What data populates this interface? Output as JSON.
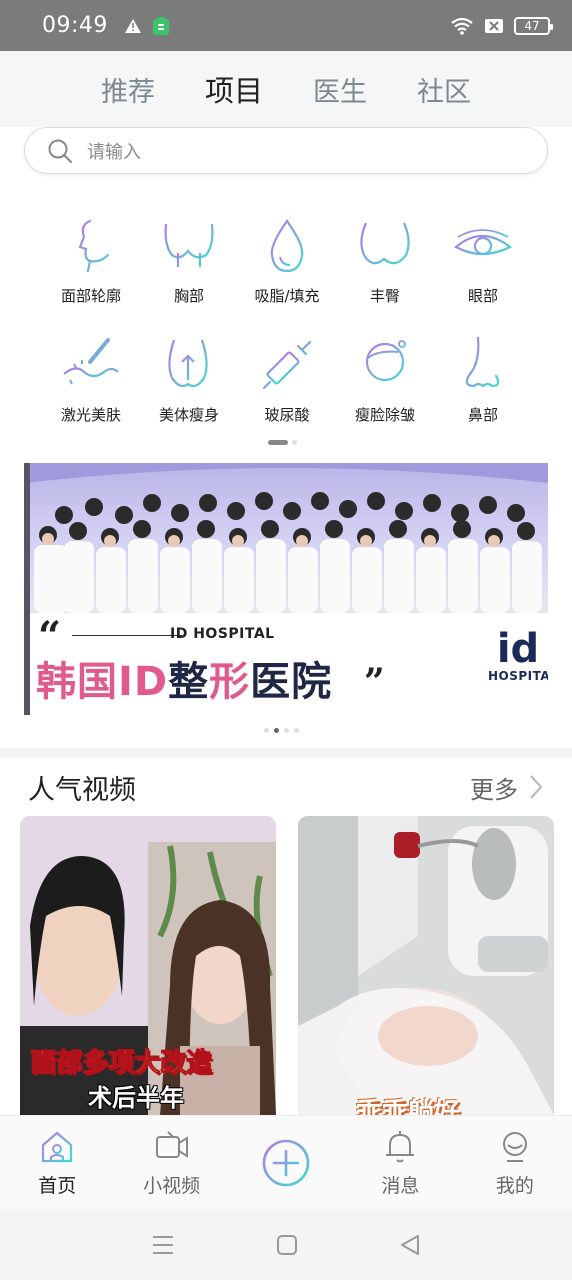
{
  "status_bar": {
    "time": "09:49",
    "battery": "47"
  },
  "top_tabs": [
    {
      "label": "推荐"
    },
    {
      "label": "项目"
    },
    {
      "label": "医生"
    },
    {
      "label": "社区"
    }
  ],
  "active_tab": "项目",
  "search": {
    "placeholder": "请输入"
  },
  "categories": [
    {
      "label": "面部轮廓",
      "icon": "face-contour-icon"
    },
    {
      "label": "胸部",
      "icon": "chest-icon"
    },
    {
      "label": "吸脂/填充",
      "icon": "liposuction-drop-icon"
    },
    {
      "label": "丰臀",
      "icon": "buttocks-icon"
    },
    {
      "label": "眼部",
      "icon": "eye-icon"
    },
    {
      "label": "激光美肤",
      "icon": "laser-skin-icon"
    },
    {
      "label": "美体瘦身",
      "icon": "body-slimming-icon"
    },
    {
      "label": "玻尿酸",
      "icon": "syringe-icon"
    },
    {
      "label": "瘦脸除皱",
      "icon": "face-lift-icon"
    },
    {
      "label": "鼻部",
      "icon": "nose-icon"
    }
  ],
  "banner": {
    "hospital_en": "ID HOSPITAL",
    "title_part1": "韩国",
    "title_part2": "ID",
    "title_part3": "整",
    "title_part4": "形",
    "title_part5": "医院",
    "logo_mark": "id",
    "logo_text": "HOSPITA"
  },
  "popular": {
    "title": "人气视频",
    "more_label": "更多",
    "videos": [
      {
        "caption_line1": "面部多项大改造",
        "caption_line2": "术后半年"
      },
      {
        "caption_line1": "乖乖躺好"
      }
    ]
  },
  "bottom_nav": [
    {
      "label": "首页",
      "icon": "home-icon"
    },
    {
      "label": "小视频",
      "icon": "video-camera-icon"
    },
    {
      "label": "",
      "icon": "plus-icon"
    },
    {
      "label": "消息",
      "icon": "bell-icon"
    },
    {
      "label": "我的",
      "icon": "profile-icon"
    }
  ],
  "colors": {
    "accent_cyan": "#40d9d2",
    "accent_purple": "#b47ae8",
    "banner_pink": "#e05a8c"
  }
}
